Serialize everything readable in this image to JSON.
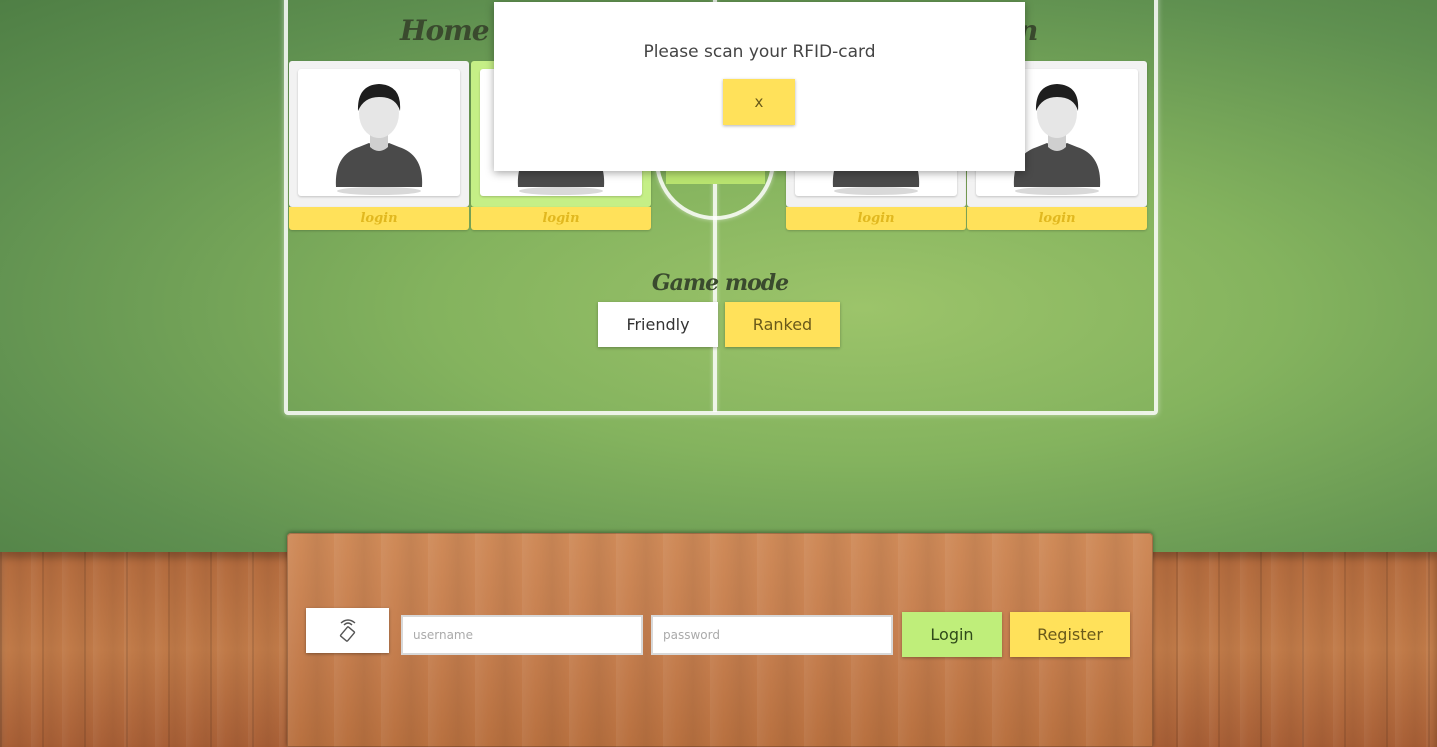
{
  "modal": {
    "message": "Please scan your RFID-card",
    "close_label": "x"
  },
  "field": {
    "home_team_heading": "Home te",
    "away_team_heading": "n",
    "players": [
      {
        "login_label": "login",
        "icon": "person-avatar-icon",
        "active": false
      },
      {
        "login_label": "login",
        "icon": "person-avatar-icon",
        "active": true
      },
      {
        "login_label": "login",
        "icon": "person-avatar-icon",
        "active": false
      },
      {
        "login_label": "login",
        "icon": "person-avatar-icon",
        "active": false
      }
    ]
  },
  "game_mode": {
    "title": "Game mode",
    "options": [
      "Friendly",
      "Ranked"
    ],
    "selected": "Ranked"
  },
  "login_panel": {
    "rfid_icon": "rfid-icon",
    "username_placeholder": "username",
    "password_placeholder": "password",
    "login_label": "Login",
    "register_label": "Register"
  },
  "colors": {
    "accent_yellow": "#ffe15a",
    "accent_green": "#bfee7a"
  }
}
